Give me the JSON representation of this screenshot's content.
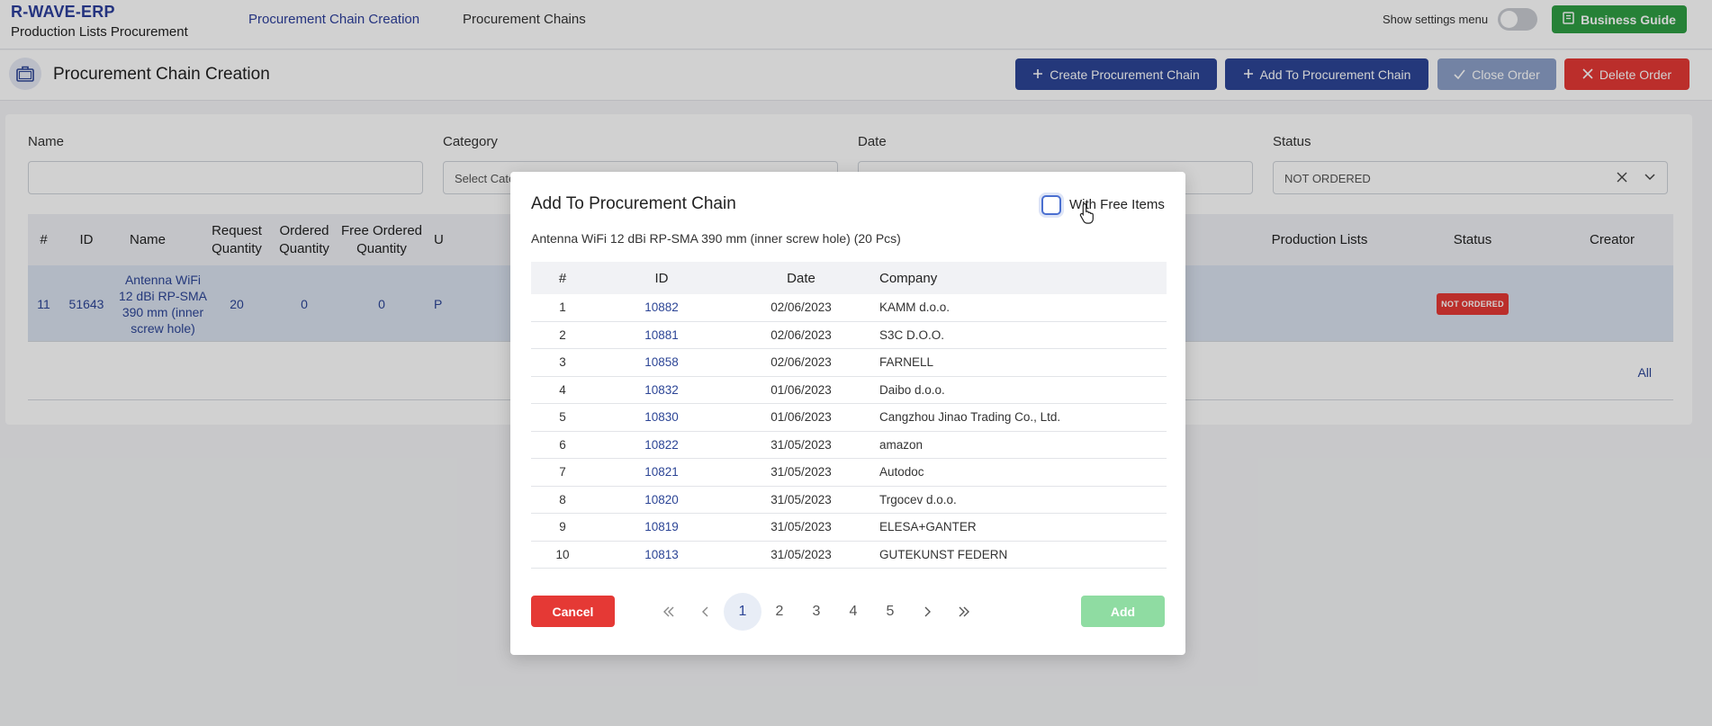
{
  "app": {
    "brand_title": "R-WAVE-ERP",
    "brand_subtitle": "Production Lists Procurement",
    "nav": [
      "Procurement Chain Creation",
      "Procurement Chains"
    ],
    "settings_label": "Show settings menu",
    "settings_toggle_on": false,
    "business_guide_label": "Business Guide"
  },
  "page": {
    "title": "Procurement Chain Creation",
    "actions": {
      "create": "Create Procurement Chain",
      "add_to": "Add To Procurement Chain",
      "close": "Close Order",
      "delete": "Delete Order"
    }
  },
  "filters": {
    "name_label": "Name",
    "category_label": "Category",
    "category_placeholder": "Select Cate",
    "date_label": "Date",
    "status_label": "Status",
    "status_value": "NOT ORDERED"
  },
  "grid": {
    "headers": {
      "num": "#",
      "id": "ID",
      "name": "Name",
      "request_qty": "Request Quantity",
      "ordered_qty": "Ordered Quantity",
      "free_ordered_qty": "Free Ordered Quantity",
      "unit": "U",
      "production_lists": "Production Lists",
      "status": "Status",
      "creator": "Creator"
    },
    "row": {
      "num": "11",
      "id": "51643",
      "name": "Antenna WiFi 12 dBi RP-SMA 390 mm (inner screw hole)",
      "request_qty": "20",
      "ordered_qty": "0",
      "free_ordered_qty": "0",
      "unit": "P",
      "status": "NOT ORDERED"
    },
    "all_link": "All"
  },
  "modal": {
    "title": "Add To Procurement Chain",
    "with_free_items_label": "With Free Items",
    "with_free_items_checked": false,
    "subtitle": "Antenna WiFi 12 dBi RP-SMA 390 mm (inner screw hole) (20 Pcs)",
    "table_headers": {
      "num": "#",
      "id": "ID",
      "date": "Date",
      "company": "Company"
    },
    "rows": [
      {
        "num": "1",
        "id": "10882",
        "date": "02/06/2023",
        "company": "KAMM d.o.o."
      },
      {
        "num": "2",
        "id": "10881",
        "date": "02/06/2023",
        "company": "S3C D.O.O."
      },
      {
        "num": "3",
        "id": "10858",
        "date": "02/06/2023",
        "company": "FARNELL"
      },
      {
        "num": "4",
        "id": "10832",
        "date": "01/06/2023",
        "company": "Daibo d.o.o."
      },
      {
        "num": "5",
        "id": "10830",
        "date": "01/06/2023",
        "company": "Cangzhou Jinao Trading Co., Ltd."
      },
      {
        "num": "6",
        "id": "10822",
        "date": "31/05/2023",
        "company": "amazon"
      },
      {
        "num": "7",
        "id": "10821",
        "date": "31/05/2023",
        "company": "Autodoc"
      },
      {
        "num": "8",
        "id": "10820",
        "date": "31/05/2023",
        "company": "Trgocev d.o.o."
      },
      {
        "num": "9",
        "id": "10819",
        "date": "31/05/2023",
        "company": "ELESA+GANTER"
      },
      {
        "num": "10",
        "id": "10813",
        "date": "31/05/2023",
        "company": "GUTEKUNST FEDERN"
      }
    ],
    "cancel_label": "Cancel",
    "add_label": "Add",
    "pagination": {
      "first": "«",
      "prev": "‹",
      "pages": [
        "1",
        "2",
        "3",
        "4",
        "5"
      ],
      "current": "1",
      "next": "›",
      "last": "»"
    }
  },
  "colors": {
    "brand": "#2d3f9c",
    "primary_button": "#2c4596",
    "disabled_button": "#8da0c9",
    "danger": "#e53935",
    "success": "#2f9e44",
    "add_disabled": "#8fdca2"
  }
}
